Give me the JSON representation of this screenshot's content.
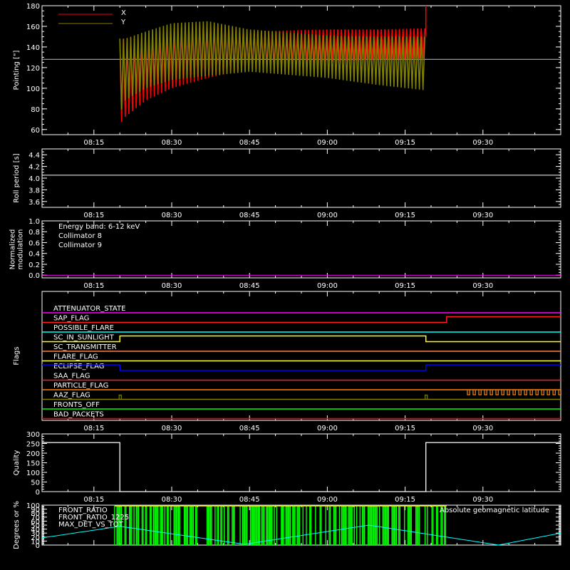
{
  "chart_data": [
    {
      "name": "pointing",
      "type": "line",
      "ylabel": "Pointing [\"]",
      "ylim": [
        55,
        180
      ],
      "yticks": [
        60,
        80,
        100,
        120,
        140,
        160,
        180
      ],
      "x_range": [
        "08:05",
        "09:45"
      ],
      "xticks": [
        "08:15",
        "08:30",
        "08:45",
        "09:00",
        "09:15",
        "09:30"
      ],
      "reference_line": 128,
      "legend": [
        {
          "label": "X",
          "color": "#ff0000"
        },
        {
          "label": "Y",
          "color": "#808000"
        }
      ],
      "series": [
        {
          "name": "X",
          "color": "#ff0000",
          "x": [
            "08:20",
            "08:21",
            "08:25",
            "08:30",
            "08:37",
            "08:45",
            "09:00",
            "09:10",
            "09:19"
          ],
          "upper": [
            148,
            148,
            150,
            158,
            162,
            155,
            157,
            157,
            158
          ],
          "lower": [
            65,
            72,
            88,
            100,
            110,
            119,
            126,
            128,
            129
          ]
        },
        {
          "name": "Y",
          "color": "#808000",
          "x": [
            "08:20",
            "08:21",
            "08:25",
            "08:30",
            "08:37",
            "08:45",
            "09:00",
            "09:10",
            "09:19"
          ],
          "upper": [
            148,
            148,
            155,
            163,
            165,
            157,
            151,
            150,
            150
          ],
          "lower": [
            75,
            88,
            100,
            108,
            112,
            116,
            110,
            103,
            98
          ]
        }
      ]
    },
    {
      "name": "roll",
      "type": "line",
      "ylabel": "Roll period [s]",
      "ylim": [
        3.5,
        4.5
      ],
      "yticks": [
        3.6,
        3.8,
        4.0,
        4.2,
        4.4
      ],
      "xticks": [
        "08:15",
        "08:30",
        "08:45",
        "09:00",
        "09:15",
        "09:30"
      ],
      "series": [
        {
          "color": "#ffffff",
          "value": 4.05
        }
      ]
    },
    {
      "name": "modulation",
      "type": "line",
      "ylabel_lines": [
        "Normalized",
        "modulation"
      ],
      "ylim": [
        -0.05,
        1.0
      ],
      "yticks": [
        0.0,
        0.2,
        0.4,
        0.6,
        0.8,
        1.0
      ],
      "xticks": [
        "08:15",
        "08:30",
        "08:45",
        "09:00",
        "09:15",
        "09:30"
      ],
      "annotations": [
        {
          "text": "Energy band: 6-12 keV",
          "color": "#ffffff"
        },
        {
          "text": "Collimator 8",
          "color": "#00ffff"
        },
        {
          "text": "Collimator 9",
          "color": "#ff00ff"
        }
      ],
      "series": [
        {
          "color": "#ff00ff",
          "value": 0.0
        }
      ]
    },
    {
      "name": "flags",
      "type": "line",
      "ylabel": "Flags",
      "xticks": [
        "08:15",
        "08:30",
        "08:45",
        "09:00",
        "09:15",
        "09:30"
      ],
      "flags": [
        {
          "label": "ATTENUATOR_STATE",
          "color": "#ff00ff",
          "changes": []
        },
        {
          "label": "SAP_FLAG",
          "color": "#ff2020",
          "changes": [
            [
              "09:23",
              1
            ]
          ]
        },
        {
          "label": "POSSIBLE_FLARE",
          "color": "#00ffff",
          "changes": []
        },
        {
          "label": "SC_IN_SUNLIGHT",
          "color": "#ffff00",
          "changes": [
            [
              "08:20",
              1
            ],
            [
              "09:19",
              0
            ]
          ]
        },
        {
          "label": "SC_TRANSMITTER",
          "color": "#ff8040",
          "changes": []
        },
        {
          "label": "FLARE_FLAG",
          "color": "#ffff40",
          "changes": []
        },
        {
          "label": "ECLIPSE_FLAG",
          "color": "#0000ff",
          "changes": [
            [
              "08:20",
              0
            ],
            [
              "09:19",
              1
            ]
          ]
        },
        {
          "label": "SAA_FLAG",
          "color": "#ff2020",
          "changes": []
        },
        {
          "label": "PARTICLE_FLAG",
          "color": "#ff8000",
          "changes": []
        },
        {
          "label": "AAZ_FLAG",
          "color": "#808000",
          "changes": []
        },
        {
          "label": "FRONTS_OFF",
          "color": "#00ff00",
          "changes": []
        },
        {
          "label": "BAD_PACKETS",
          "color": "#ff0000",
          "changes": []
        }
      ]
    },
    {
      "name": "quality",
      "type": "line",
      "ylabel": "Quality",
      "ylim": [
        0,
        300
      ],
      "yticks": [
        0,
        50,
        100,
        150,
        200,
        250,
        300
      ],
      "xticks": [
        "08:15",
        "08:30",
        "08:45",
        "09:00",
        "09:15",
        "09:30"
      ],
      "series": [
        {
          "color": "#ffffff",
          "x": [
            "08:05",
            "08:20",
            "08:20",
            "09:19",
            "09:19",
            "09:45"
          ],
          "y": [
            255,
            255,
            0,
            0,
            255,
            255
          ]
        }
      ]
    },
    {
      "name": "ratios",
      "type": "line",
      "ylabel": "Degrees or %",
      "ylim": [
        0,
        100
      ],
      "yticks": [
        0,
        10,
        20,
        30,
        40,
        50,
        60,
        70,
        80,
        90,
        100
      ],
      "legend": [
        {
          "label": "FRONT_RATIO",
          "color": "#ffff00"
        },
        {
          "label": "FRONT_RATIO_1225",
          "color": "#00ff00"
        },
        {
          "label": "MAX_DET_VS_TOT",
          "color": "#ff8000"
        }
      ],
      "annotation": {
        "text": "Absolute geomagnetic latitude",
        "color": "#00ffff"
      },
      "latitude": {
        "x": [
          "08:05",
          "08:20",
          "08:44",
          "09:08",
          "09:33",
          "09:45"
        ],
        "y": [
          18,
          47,
          2,
          50,
          0,
          30
        ]
      }
    }
  ]
}
